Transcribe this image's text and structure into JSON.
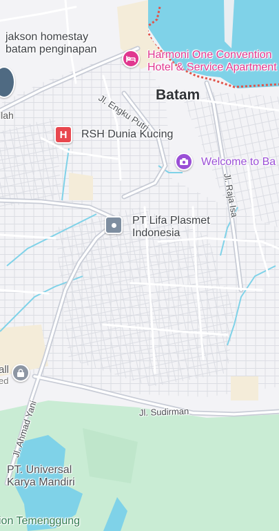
{
  "colors": {
    "water": "#7fd2e8",
    "park": "#c9ecd4",
    "land": "#f3f3f6",
    "road": "#ffffff",
    "arterial": "#c8ccd6",
    "hospital": "#e8474e",
    "hotel": "#e0378f",
    "attraction": "#9a4fd6",
    "business": "#7e8ea0",
    "boundary": "#e0544a"
  },
  "places": {
    "city": "Batam",
    "homestay_line1": "jakson homestay",
    "homestay_line2": "batam penginapan",
    "hotel_line1": "Harmoni One Convention",
    "hotel_line2": "Hotel & Service Apartment",
    "hospital": "RSH Dunia Kucing",
    "attraction": "Welcome to Ba",
    "business_line1": "PT Lifa Plasmet",
    "business_line2": "Indonesia",
    "company_line1": "PT. Universal",
    "company_line2": "Karya Mandiri",
    "park": "ion Temenggung",
    "left_partial_1": "llah",
    "left_partial_2": "all",
    "left_partial_3": "ed"
  },
  "roads": {
    "engku_putri": "Jl. Engku Putri",
    "raja_isa": "Jl. Raja Isa",
    "sudirman": "Jl. Sudirman",
    "ahmad_yani": "Jl. Ahmad Yani"
  },
  "icons": {
    "hotel": "bed-icon",
    "hospital": "hospital-h-icon",
    "attraction": "camera-icon",
    "business": "business-dot-icon",
    "mall": "shopping-bag-icon"
  }
}
